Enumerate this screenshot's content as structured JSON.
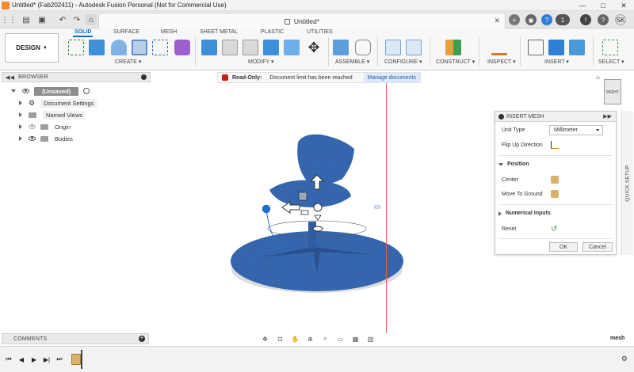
{
  "window": {
    "title": "Untitled* (Fab202411) - Autodesk Fusion Personal (Not for Commercial Use)"
  },
  "tabbar": {
    "doc_title": "Untitled*",
    "notif_count": "1",
    "user": "SK"
  },
  "ribbon": {
    "design_label": "DESIGN",
    "tabs": [
      "SOLID",
      "SURFACE",
      "MESH",
      "SHEET METAL",
      "PLASTIC",
      "UTILITIES"
    ],
    "active_tab": "SOLID",
    "groups": [
      "CREATE",
      "MODIFY",
      "ASSEMBLE",
      "CONFIGURE",
      "CONSTRUCT",
      "INSPECT",
      "INSERT",
      "SELECT"
    ]
  },
  "browser": {
    "title": "BROWSER",
    "items": [
      "(Unsaved)",
      "Document Settings",
      "Named Views",
      "Origin",
      "Bodies"
    ]
  },
  "notice": {
    "read_only": "Read-Only:",
    "message": "Document limit has been reached",
    "manage": "Manage documents"
  },
  "viewcube": {
    "face": "RIGHT"
  },
  "insert_mesh": {
    "title": "INSERT MESH",
    "unit_type_label": "Unit Type",
    "unit_type_value": "Millimeter",
    "flip_up_label": "Flip Up Direction",
    "position_section": "Position",
    "center_label": "Center",
    "move_to_ground_label": "Move To Ground",
    "numerical_inputs": "Numerical Inputs",
    "reset_label": "Reset",
    "ok": "OK",
    "cancel": "Cancel"
  },
  "quick_setup": "QUICK SETUP",
  "comments": {
    "title": "COMMENTS"
  },
  "status": {
    "mesh_label": "mesh"
  },
  "colors": {
    "accent": "#0a6dc2",
    "mesh_blue": "#3a6fb8",
    "read_only_red": "#c81e1e"
  }
}
